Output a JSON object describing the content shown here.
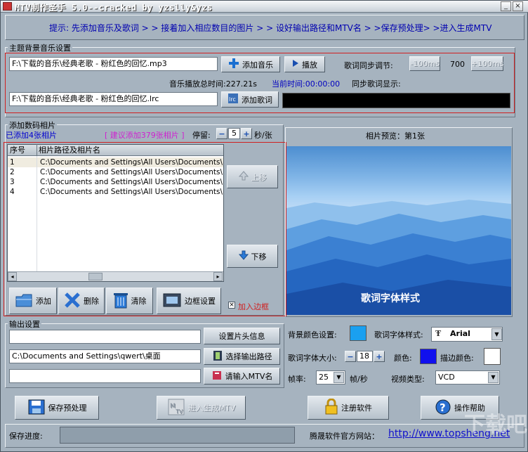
{
  "window": {
    "title": "MTV制作圣手 5.0--cracked by yzslly&yzs",
    "minimize_glyph": "_",
    "close_glyph": "×"
  },
  "hint": {
    "text": "提示: 先添加音乐及歌词 > > 接着加入相应数目的图片 > > 设好输出路径和MTV名 > >保存预处理> >进入生成MTV"
  },
  "music": {
    "group_label": "主题背景音乐设置",
    "music_path": "F:\\下载的音乐\\经典老歌 - 粉红色的回忆.mp3",
    "add_music": "添加音乐",
    "play": "播放",
    "sync_label": "歌词同步调节:",
    "minus": "-100ms",
    "offset": "700",
    "plus": "+100ms",
    "total_time_label": "音乐播放总时间:227.21s",
    "current_time_label": "当前时间:00:00:00",
    "sync_display_label": "同步歌词显示:",
    "lyric_path": "F:\\下载的音乐\\经典老歌 - 粉红色的回忆.lrc",
    "add_lyric": "添加歌词"
  },
  "photos": {
    "group_label": "添加数码相片",
    "added": "已添加4张相片",
    "suggest": "[ 建议添加379张相片 ]",
    "pause_label": "停留:",
    "pause_minus": "−",
    "pause_value": "5",
    "pause_plus": "+",
    "pause_unit": "秒/张",
    "columns": [
      "序号",
      "相片路径及相片名"
    ],
    "rows": [
      {
        "no": "1",
        "path": "C:\\Documents and Settings\\All Users\\Documents\\..."
      },
      {
        "no": "2",
        "path": "C:\\Documents and Settings\\All Users\\Documents\\..."
      },
      {
        "no": "3",
        "path": "C:\\Documents and Settings\\All Users\\Documents\\..."
      },
      {
        "no": "4",
        "path": "C:\\Documents and Settings\\All Users\\Documents\\..."
      }
    ],
    "move_up": "上移",
    "move_down": "下移",
    "add": "添加",
    "delete": "删除",
    "clear": "清除",
    "frame_settings": "边框设置",
    "add_frame": "加入边框"
  },
  "preview": {
    "header": "相片预览：第1张",
    "lyric_style_text": "歌词字体样式"
  },
  "output": {
    "group_label": "输出设置",
    "header_info": "设置片头信息",
    "output_path": "C:\\Documents and Settings\\qwert\\桌面",
    "select_path": "选择输出路径",
    "mtv_name_btn": "请输入MTV名",
    "bg_color_label": "背景颜色设置:",
    "font_style_label": "歌词字体样式:",
    "font_value": "Arial",
    "font_size_label": "歌词字体大小:",
    "size_minus": "−",
    "font_size": "18",
    "size_plus": "+",
    "color_label": "颜色:",
    "stroke_label": "描边颜色:",
    "fps_label": "帧率:",
    "fps": "25",
    "fps_unit": "帧/秒",
    "video_type_label": "视频类型:",
    "video_type": "VCD",
    "bg_color": "#1aa0f0",
    "text_color": "#1010ee",
    "stroke_color": "#ffffff"
  },
  "actions": {
    "save_preprocess": "保存预处理",
    "enter_generate": "进入生成MTV",
    "register": "注册软件",
    "help": "操作帮助"
  },
  "status": {
    "progress_label": "保存进度:",
    "site_label": "腾晟软件官方网站：",
    "site_url": "http://www.topsheng.net",
    "watermark": "下载吧"
  }
}
